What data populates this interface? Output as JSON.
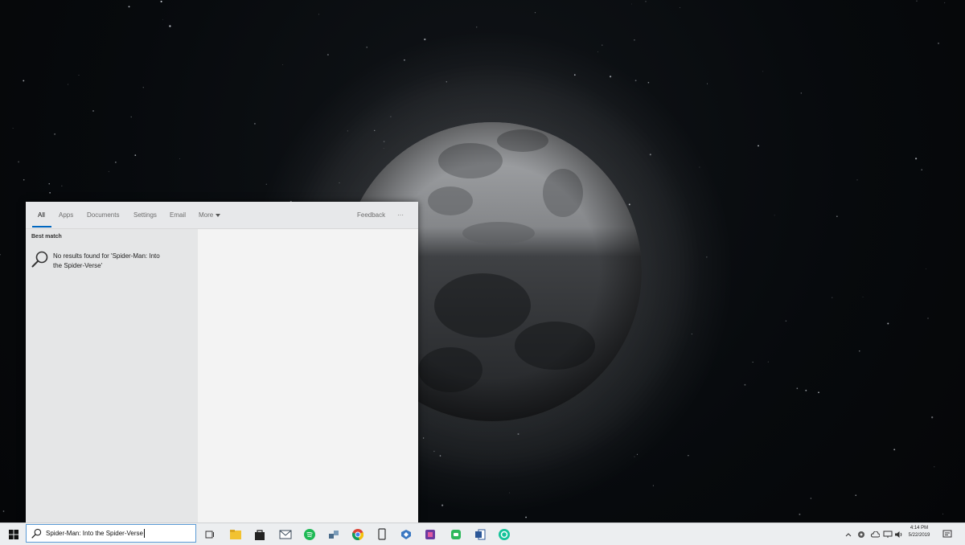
{
  "search_flyout": {
    "tabs": [
      {
        "label": "All",
        "active": true
      },
      {
        "label": "Apps"
      },
      {
        "label": "Documents"
      },
      {
        "label": "Settings"
      },
      {
        "label": "Email"
      },
      {
        "label": "More"
      }
    ],
    "feedback_label": "Feedback",
    "overflow_label": "···",
    "best_match_heading": "Best match",
    "result_line1": "No results found for 'Spider-Man: Into",
    "result_line2": "the Spider-Verse'"
  },
  "taskbar": {
    "search_value": "Spider-Man: Into the Spider-Verse",
    "apps": [
      {
        "icon": "task-view-icon"
      },
      {
        "icon": "file-explorer-icon",
        "color": "#f2c230"
      },
      {
        "icon": "store-icon",
        "color": "#222222"
      },
      {
        "icon": "mail-icon",
        "color": "#3b4a5a"
      },
      {
        "icon": "spotify-icon",
        "color": "#1db954"
      },
      {
        "icon": "network-app-icon",
        "color": "#4a6b8a"
      },
      {
        "icon": "chrome-icon"
      },
      {
        "icon": "phone-icon",
        "color": "#333333"
      },
      {
        "icon": "vpn-icon",
        "color": "#3a78c2"
      },
      {
        "icon": "media-app-icon",
        "color": "#6a3aa0"
      },
      {
        "icon": "messages-icon",
        "color": "#2eb85c"
      },
      {
        "icon": "word-icon",
        "color": "#2b5797"
      },
      {
        "icon": "grammarly-icon",
        "color": "#15c39a"
      }
    ],
    "tray": {
      "time": "4:14 PM",
      "date": "5/22/2019"
    }
  },
  "colors": {
    "accent": "#0067c0",
    "flyout_left_bg": "#e5e6e7",
    "flyout_right_bg": "#f3f3f3"
  }
}
